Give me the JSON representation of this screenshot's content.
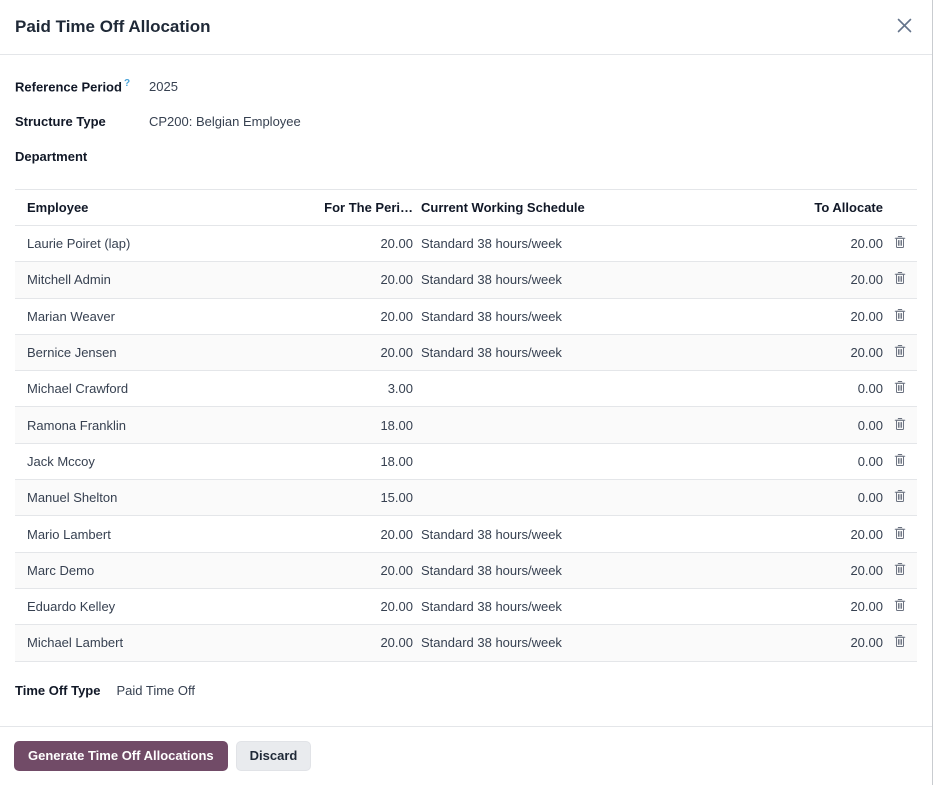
{
  "dialog": {
    "title": "Paid Time Off Allocation"
  },
  "icons": {
    "close": "x-cross",
    "delete": "trash-can",
    "help": "?"
  },
  "fields": {
    "reference_period": {
      "label": "Reference Period",
      "help_symbol": "?",
      "value": "2025"
    },
    "structure_type": {
      "label": "Structure Type",
      "value": "CP200: Belgian Employee"
    },
    "department": {
      "label": "Department",
      "value": ""
    },
    "time_off_type": {
      "label": "Time Off Type",
      "value": "Paid Time Off"
    }
  },
  "table": {
    "headers": {
      "employee": "Employee",
      "period": "For The Peri…",
      "schedule": "Current Working Schedule",
      "allocate": "To Allocate"
    },
    "rows": [
      {
        "employee": "Laurie Poiret (lap)",
        "period": "20.00",
        "schedule": "Standard 38 hours/week",
        "allocate": "20.00"
      },
      {
        "employee": "Mitchell Admin",
        "period": "20.00",
        "schedule": "Standard 38 hours/week",
        "allocate": "20.00"
      },
      {
        "employee": "Marian Weaver",
        "period": "20.00",
        "schedule": "Standard 38 hours/week",
        "allocate": "20.00"
      },
      {
        "employee": "Bernice Jensen",
        "period": "20.00",
        "schedule": "Standard 38 hours/week",
        "allocate": "20.00"
      },
      {
        "employee": "Michael Crawford",
        "period": "3.00",
        "schedule": "",
        "allocate": "0.00"
      },
      {
        "employee": "Ramona Franklin",
        "period": "18.00",
        "schedule": "",
        "allocate": "0.00"
      },
      {
        "employee": "Jack Mccoy",
        "period": "18.00",
        "schedule": "",
        "allocate": "0.00"
      },
      {
        "employee": "Manuel Shelton",
        "period": "15.00",
        "schedule": "",
        "allocate": "0.00"
      },
      {
        "employee": "Mario Lambert",
        "period": "20.00",
        "schedule": "Standard 38 hours/week",
        "allocate": "20.00"
      },
      {
        "employee": "Marc Demo",
        "period": "20.00",
        "schedule": "Standard 38 hours/week",
        "allocate": "20.00"
      },
      {
        "employee": "Eduardo Kelley",
        "period": "20.00",
        "schedule": "Standard 38 hours/week",
        "allocate": "20.00"
      },
      {
        "employee": "Michael Lambert",
        "period": "20.00",
        "schedule": "Standard 38 hours/week",
        "allocate": "20.00"
      }
    ]
  },
  "footer": {
    "generate_label": "Generate Time Off Allocations",
    "discard_label": "Discard"
  },
  "colors": {
    "primary": "#714B67",
    "secondary_bg": "#e9ebee",
    "help": "#4aa3d8",
    "border": "#e4e6e9",
    "row_alt": "#fafafa",
    "text": "#374151",
    "heading": "#111827"
  }
}
